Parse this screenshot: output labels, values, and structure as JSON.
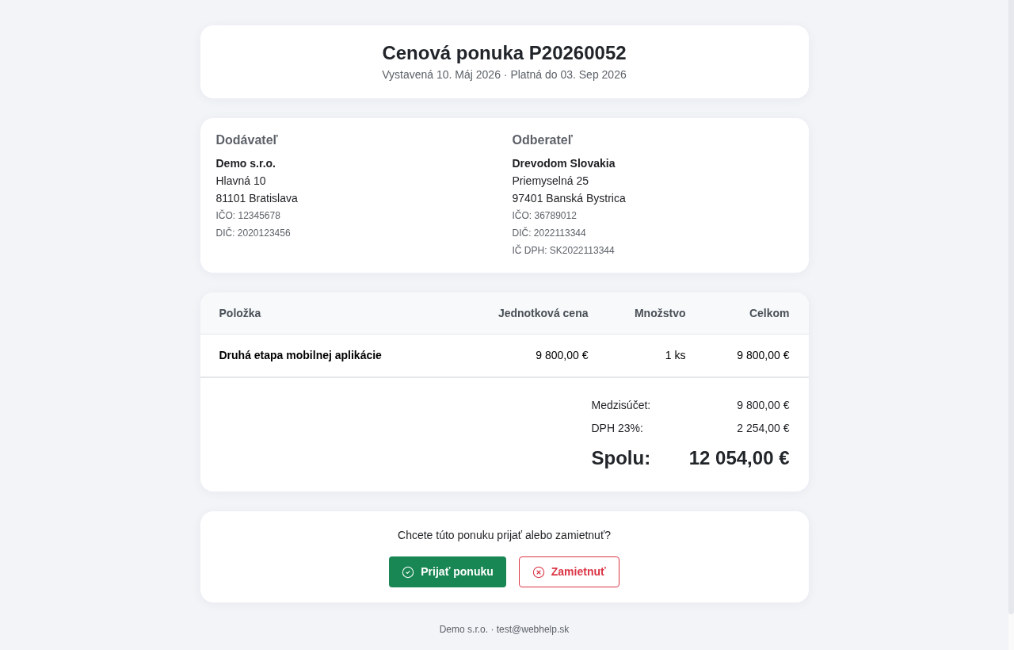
{
  "header": {
    "title": "Cenová ponuka P20260052",
    "subtitle": "Vystavená 10. Máj 2026 · Platná do 03. Sep 2026"
  },
  "parties": [
    {
      "heading": "Dodávateľ",
      "name": "Demo s.r.o.",
      "address": [
        "Hlavná 10",
        "81101 Bratislava"
      ],
      "ids": [
        "IČO: 12345678",
        "DIČ: 2020123456"
      ]
    },
    {
      "heading": "Odberateľ",
      "name": "Drevodom Slovakia",
      "address": [
        "Priemyselná 25",
        "97401 Banská Bystrica"
      ],
      "ids": [
        "IČO: 36789012",
        "DIČ: 2022113344",
        "IČ DPH: SK2022113344"
      ]
    }
  ],
  "table": {
    "columns": [
      "Položka",
      "Jednotková cena",
      "Množstvo",
      "Celkom"
    ],
    "rows": [
      {
        "cells": [
          "Druhá etapa mobilnej aplikácie",
          "9 800,00 €",
          "1 ks",
          "9 800,00 €"
        ]
      }
    ]
  },
  "totals": [
    {
      "kind": "line",
      "label": "Medzisúčet:",
      "value": "9 800,00 €"
    },
    {
      "kind": "line",
      "label": "DPH 23%:",
      "value": "2 254,00 €"
    },
    {
      "kind": "grand",
      "label": "Spolu:",
      "value": "12 054,00 €"
    }
  ],
  "decision": {
    "question": "Chcete túto ponuku prijať alebo zamietnuť?",
    "buttons": [
      {
        "kind": "accept",
        "label": "Prijať ponuku"
      },
      {
        "kind": "reject",
        "label": "Zamietnuť"
      }
    ]
  },
  "footer": "Demo s.r.o. · test@webhelp.sk"
}
